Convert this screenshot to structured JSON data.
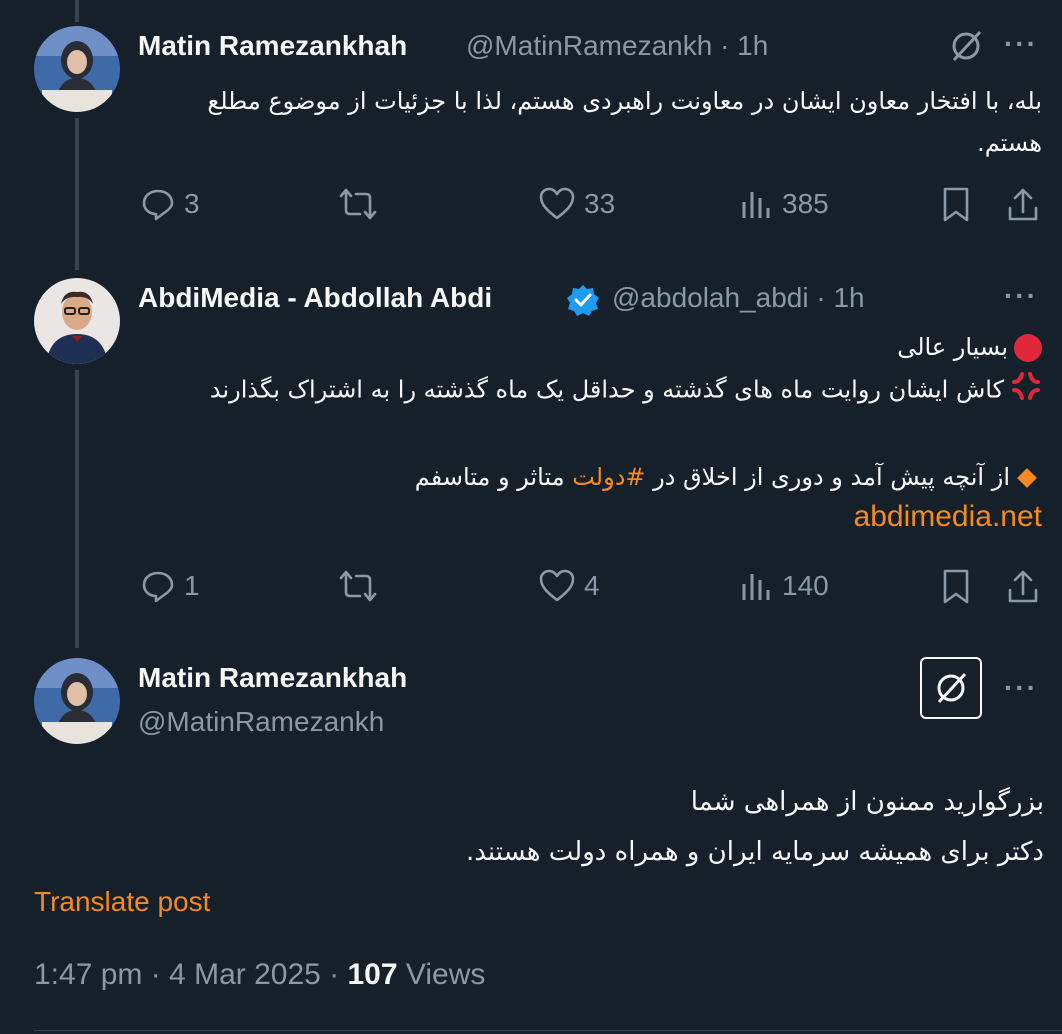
{
  "post1": {
    "name": "Matin Ramezankhah",
    "handle_time": "@MatinRamezankh · 1h",
    "text": "بله، با افتخار معاون ایشان در معاونت راهبردی هستم، لذا با جزئیات از موضوع مطلع هستم.",
    "replies": "3",
    "likes": "33",
    "views": "385"
  },
  "post2": {
    "name": "AbdiMedia - Abdollah Abdi",
    "handle_time": "@abdolah_abdi · 1h",
    "line1": "بسیار عالی",
    "line2": "کاش ایشان روایت ماه های گذشته و حداقل یک ماه گذشته را به اشتراک بگذارند",
    "line3_pre": "از آنچه پیش آمد و دوری از اخلاق در ",
    "hashtag": "#دولت",
    "line3_post": " متاثر و متاسفم",
    "link": "abdimedia.net",
    "replies": "1",
    "likes": "4",
    "views": "140"
  },
  "main": {
    "name": "Matin Ramezankhah",
    "handle": "@MatinRamezankh",
    "line1": "بزرگوارید ممنون از همراهی شما",
    "line2": "دکتر برای همیشه سرمایه ایران و همراه دولت هستند.",
    "translate": "Translate post",
    "time": "1:47 pm · 4 Mar 2025 · ",
    "views_count": "107",
    "views_label": " Views"
  },
  "colors": {
    "accent": "#f6891f",
    "verified": "#1d9bf0",
    "bg": "#15202b",
    "muted": "#8b98a5"
  }
}
